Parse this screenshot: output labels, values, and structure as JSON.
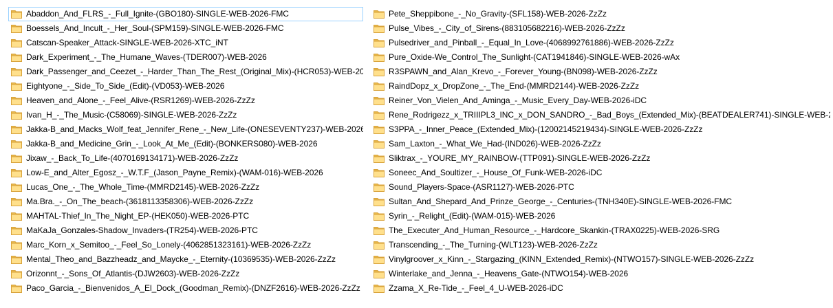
{
  "colors": {
    "folder_body": "#ffe08c",
    "folder_tab": "#e8b84a",
    "folder_edge": "#d8a23a",
    "focus_outline": "#99d1ff",
    "text": "#000000"
  },
  "icons": {
    "item_icon": "folder-icon"
  },
  "folders": {
    "column_1": [
      "Abaddon_And_FLRS_-_Full_Ignite-(GBO180)-SINGLE-WEB-2026-FMC",
      "Boessels_And_Incult_-_Her_Soul-(SPM159)-SINGLE-WEB-2026-FMC",
      "Catscan-Speaker_Attack-SINGLE-WEB-2026-XTC_iNT",
      "Dark_Experiment_-_The_Humane_Waves-(TDER007)-WEB-2026",
      "Dark_Passenger_and_Ceezet_-_Harder_Than_The_Rest_(Original_Mix)-(HCR053)-WEB-2026",
      "Eightyone_-_Side_To_Side_(Edit)-(VD053)-WEB-2026",
      "Heaven_and_Alone_-_Feel_Alive-(RSR1269)-WEB-2026-ZzZz",
      "Ivan_H_-_The_Music-(C58069)-SINGLE-WEB-2026-ZzZz",
      "Jakka-B_and_Macks_Wolf_feat_Jennifer_Rene_-_New_Life-(ONESEVENTY237)-WEB-2026-ZzZz",
      "Jakka-B_and_Medicine_Grin_-_Look_At_Me_(Edit)-(BONKERS080)-WEB-2026",
      "Jixaw_-_Back_To_Life-(4070169134171)-WEB-2026-ZzZz",
      "Low-E_and_Alter_Egosz_-_W.T.F_(Jason_Payne_Remix)-(WAM-016)-WEB-2026",
      "Lucas_One_-_The_Whole_Time-(MMRD2145)-WEB-2026-ZzZz",
      "Ma.Bra._-_On_The_beach-(3618113358306)-WEB-2026-ZzZz",
      "MAHTAL-Thief_In_The_Night_EP-(HEK050)-WEB-2026-PTC",
      "MaKaJa_Gonzales-Shadow_Invaders-(TR254)-WEB-2026-PTC",
      "Marc_Korn_x_Semitoo_-_Feel_So_Lonely-(4062851323161)-WEB-2026-ZzZz",
      "Mental_Theo_and_Bazzheadz_and_Maycke_-_Eternity-(10369535)-WEB-2026-ZzZz",
      "Orizonnt_-_Sons_Of_Atlantis-(DJW2603)-WEB-2026-ZzZz",
      "Paco_Garcia_-_Bienvenidos_A_El_Dock_(Goodman_Remix)-(DNZF2616)-WEB-2026-ZzZz"
    ],
    "column_2": [
      "Pete_Sheppibone_-_No_Gravity-(SFL158)-WEB-2026-ZzZz",
      "Pulse_Vibes_-_City_of_Sirens-(883105682216)-WEB-2026-ZzZz",
      "Pulsedriver_and_Pinball_-_Equal_In_Love-(4068992761886)-WEB-2026-ZzZz",
      "Pure_Oxide-We_Control_The_Sunlight-(CAT1941846)-SINGLE-WEB-2026-wAx",
      "R3SPAWN_and_Alan_Krevo_-_Forever_Young-(BN098)-WEB-2026-ZzZz",
      "RaindDopz_x_DropZone_-_The_End-(MMRD2144)-WEB-2026-ZzZz",
      "Reiner_Von_Vielen_And_Aminga_-_Music_Every_Day-WEB-2026-iDC",
      "Rene_Rodrigezz_x_TRIIIPL3_INC_x_DON_SANDRO_-_Bad_Boys_(Extended_Mix)-(BEATDEALER741)-SINGLE-WEB-2026-ZzZz",
      "S3PPA_-_Inner_Peace_(Extended_Mix)-(12002145219434)-SINGLE-WEB-2026-ZzZz",
      "Sam_Laxton_-_What_We_Had-(IND026)-WEB-2026-ZzZz",
      "Sliktrax_-_YOURE_MY_RAINBOW-(TTP091)-SINGLE-WEB-2026-ZzZz",
      "Soneec_And_Soultizer_-_House_Of_Funk-WEB-2026-iDC",
      "Sound_Players-Space-(ASR1127)-WEB-2026-PTC",
      "Sultan_And_Shepard_And_Prinze_George_-_Centuries-(TNH340E)-SINGLE-WEB-2026-FMC",
      "Syrin_-_Relight_(Edit)-(WAM-015)-WEB-2026",
      "The_Executer_And_Human_Resource_-_Hardcore_Skankin-(TRAX0225)-WEB-2026-SRG",
      "Transcending_-_The_Turning-(WLT123)-WEB-2026-ZzZz",
      "Vinylgroover_x_Kinn_-_Stargazing_(KINN_Extended_Remix)-(NTWO157)-SINGLE-WEB-2026-ZzZz",
      "Winterlake_and_Jenna_-_Heavens_Gate-(NTWO154)-WEB-2026",
      "Zzama_X_Re-Tide_-_Feel_4_U-WEB-2026-iDC"
    ]
  }
}
